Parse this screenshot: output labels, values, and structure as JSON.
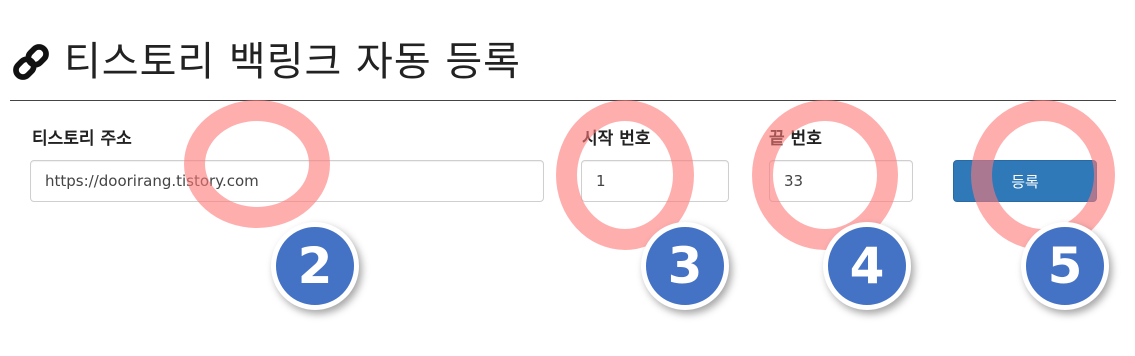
{
  "page": {
    "title": "티스토리 백링크 자동 등록",
    "title_icon": "link-icon"
  },
  "form": {
    "blog_url": {
      "label": "티스토리 주소",
      "value": "https://doorirang.tistory.com"
    },
    "start_no": {
      "label": "시작 번호",
      "value": "1"
    },
    "end_no": {
      "label": "끝 번호",
      "value": "33"
    },
    "submit_label": "등록"
  },
  "annotations": {
    "ring_color": "#ff7878",
    "badge_color": "#4472c4",
    "badges": [
      "2",
      "3",
      "4",
      "5"
    ]
  }
}
